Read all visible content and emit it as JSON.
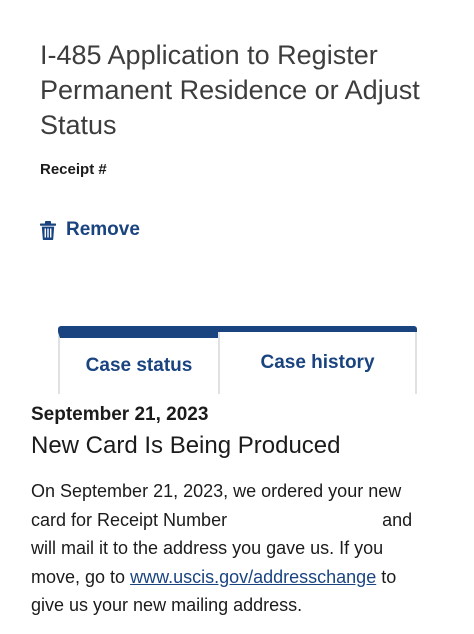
{
  "case": {
    "form_title": "I-485 Application to Register Permanent Residence or Adjust Status",
    "receipt_label": "Receipt #",
    "remove_label": "Remove",
    "remove_icon": "trash-icon"
  },
  "tabs": [
    {
      "label": "Case status",
      "active": true
    },
    {
      "label": "Case history",
      "active": false
    }
  ],
  "status": {
    "date": "September 21, 2023",
    "title": "New Card Is Being Produced",
    "body_part1": "On September 21, 2023, we ordered your new card for Receipt Number",
    "body_part2": "and will mail it to the address you gave us. If you move, go to",
    "link_text": "www.uscis.gov/addresschange",
    "body_part3": "to give us your new mailing address."
  },
  "colors": {
    "accent": "#1a4480",
    "text": "#1b1b1b",
    "tab_border": "#dfe1e2"
  }
}
